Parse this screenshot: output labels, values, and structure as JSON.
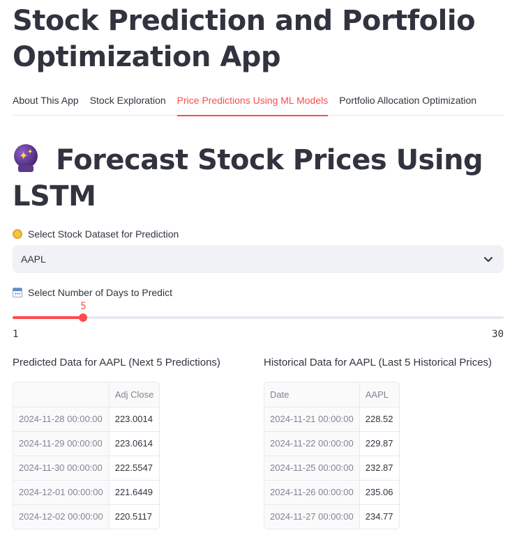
{
  "header": {
    "title": "Stock Prediction and Portfolio Optimization App"
  },
  "tabs": [
    {
      "label": "About This App",
      "active": false
    },
    {
      "label": "Stock Exploration",
      "active": false
    },
    {
      "label": "Price Predictions Using ML Models",
      "active": true
    },
    {
      "label": "Portfolio Allocation Optimization",
      "active": false
    }
  ],
  "section": {
    "icon": "crystal-ball-icon",
    "title": "Forecast Stock Prices Using LSTM"
  },
  "dataset_select": {
    "icon": "coin-icon",
    "label": "Select Stock Dataset for Prediction",
    "value": "AAPL"
  },
  "days_slider": {
    "icon": "calendar-icon",
    "label": "Select Number of Days to Predict",
    "value": 5,
    "min": 1,
    "max": 30,
    "value_label": "5",
    "min_label": "1",
    "max_label": "30"
  },
  "predicted": {
    "title": "Predicted Data for AAPL (Next 5 Predictions)",
    "columns": [
      "",
      "Adj Close"
    ],
    "rows": [
      [
        "2024-11-28 00:00:00",
        "223.0014"
      ],
      [
        "2024-11-29 00:00:00",
        "223.0614"
      ],
      [
        "2024-11-30 00:00:00",
        "222.5547"
      ],
      [
        "2024-12-01 00:00:00",
        "221.6449"
      ],
      [
        "2024-12-02 00:00:00",
        "220.5117"
      ]
    ]
  },
  "historical": {
    "title": "Historical Data for AAPL (Last 5 Historical Prices)",
    "columns": [
      "Date",
      "AAPL"
    ],
    "rows": [
      [
        "2024-11-21 00:00:00",
        "228.52"
      ],
      [
        "2024-11-22 00:00:00",
        "229.87"
      ],
      [
        "2024-11-25 00:00:00",
        "232.87"
      ],
      [
        "2024-11-26 00:00:00",
        "235.06"
      ],
      [
        "2024-11-27 00:00:00",
        "234.77"
      ]
    ]
  },
  "colors": {
    "accent": "#ff4b4b",
    "text": "#31333f",
    "muted": "#808495",
    "input_bg": "#f0f2f6"
  }
}
